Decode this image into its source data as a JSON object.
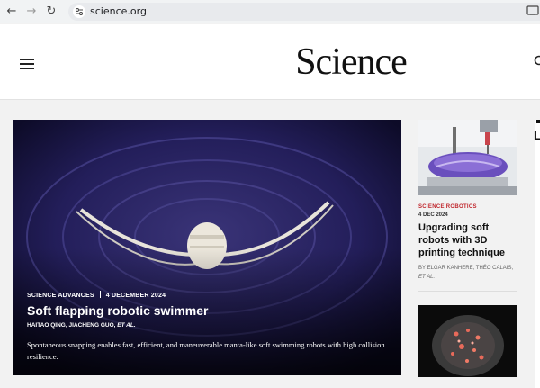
{
  "browser": {
    "url": "science.org",
    "back_icon": "arrow-left-icon",
    "forward_icon": "arrow-right-icon",
    "reload_icon": "reload-icon"
  },
  "header": {
    "logo": "Science",
    "menu_icon": "hamburger-menu-icon",
    "search_icon": "search-icon"
  },
  "hero": {
    "journal": "SCIENCE ADVANCES",
    "date": "4 DECEMBER 2024",
    "title": "Soft flapping robotic swimmer",
    "authors": "HAITAO QING,  JIACHENG GUO,",
    "authors_etal": "ET AL.",
    "description": "Spontaneous snapping enables fast, efficient, and maneuverable manta-like soft swimming robots with high collision resilience."
  },
  "side_article": {
    "journal": "SCIENCE ROBOTICS",
    "date": "4 DEC 2024",
    "title": "Upgrading soft robots with 3D printing technique",
    "authors": "BY ELGAR KANHERE, THÉO CALAIS,",
    "authors_etal": "ET AL."
  },
  "edge": {
    "letter": "L"
  },
  "colors": {
    "kicker": "#c0272d",
    "hero_bg": "#1e1a4f"
  }
}
